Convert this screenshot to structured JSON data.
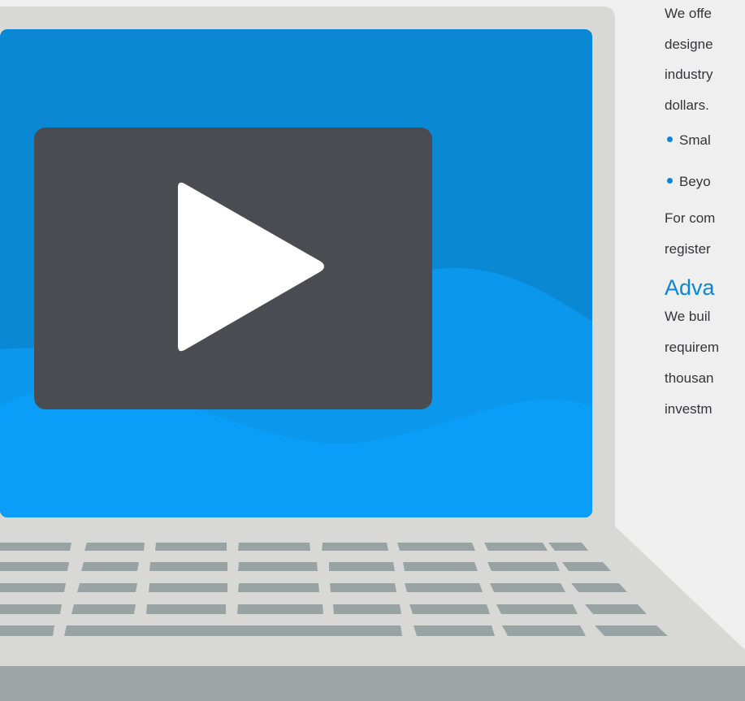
{
  "video": {
    "play_button_icon": "play-icon",
    "colors": {
      "screen_top": "#0a8ad6",
      "screen_wave": "#0b9cf5",
      "player_bg": "#4b4c51",
      "laptop_frame": "#d8d8d6",
      "keys": "#9aa3a4",
      "base": "#9ea5a6"
    }
  },
  "content": {
    "intro_lines": [
      "We offe",
      "designe",
      "industry",
      "dollars."
    ],
    "bullets": [
      "Smal",
      "Beyo"
    ],
    "followup_lines": [
      "For com",
      "register"
    ],
    "heading": "Adva",
    "section_lines": [
      "We buil",
      "requirem",
      "thousan",
      "investm"
    ],
    "colors": {
      "heading": "#0a87d8",
      "bullet": "#0a87d8",
      "text": "#333538"
    }
  }
}
